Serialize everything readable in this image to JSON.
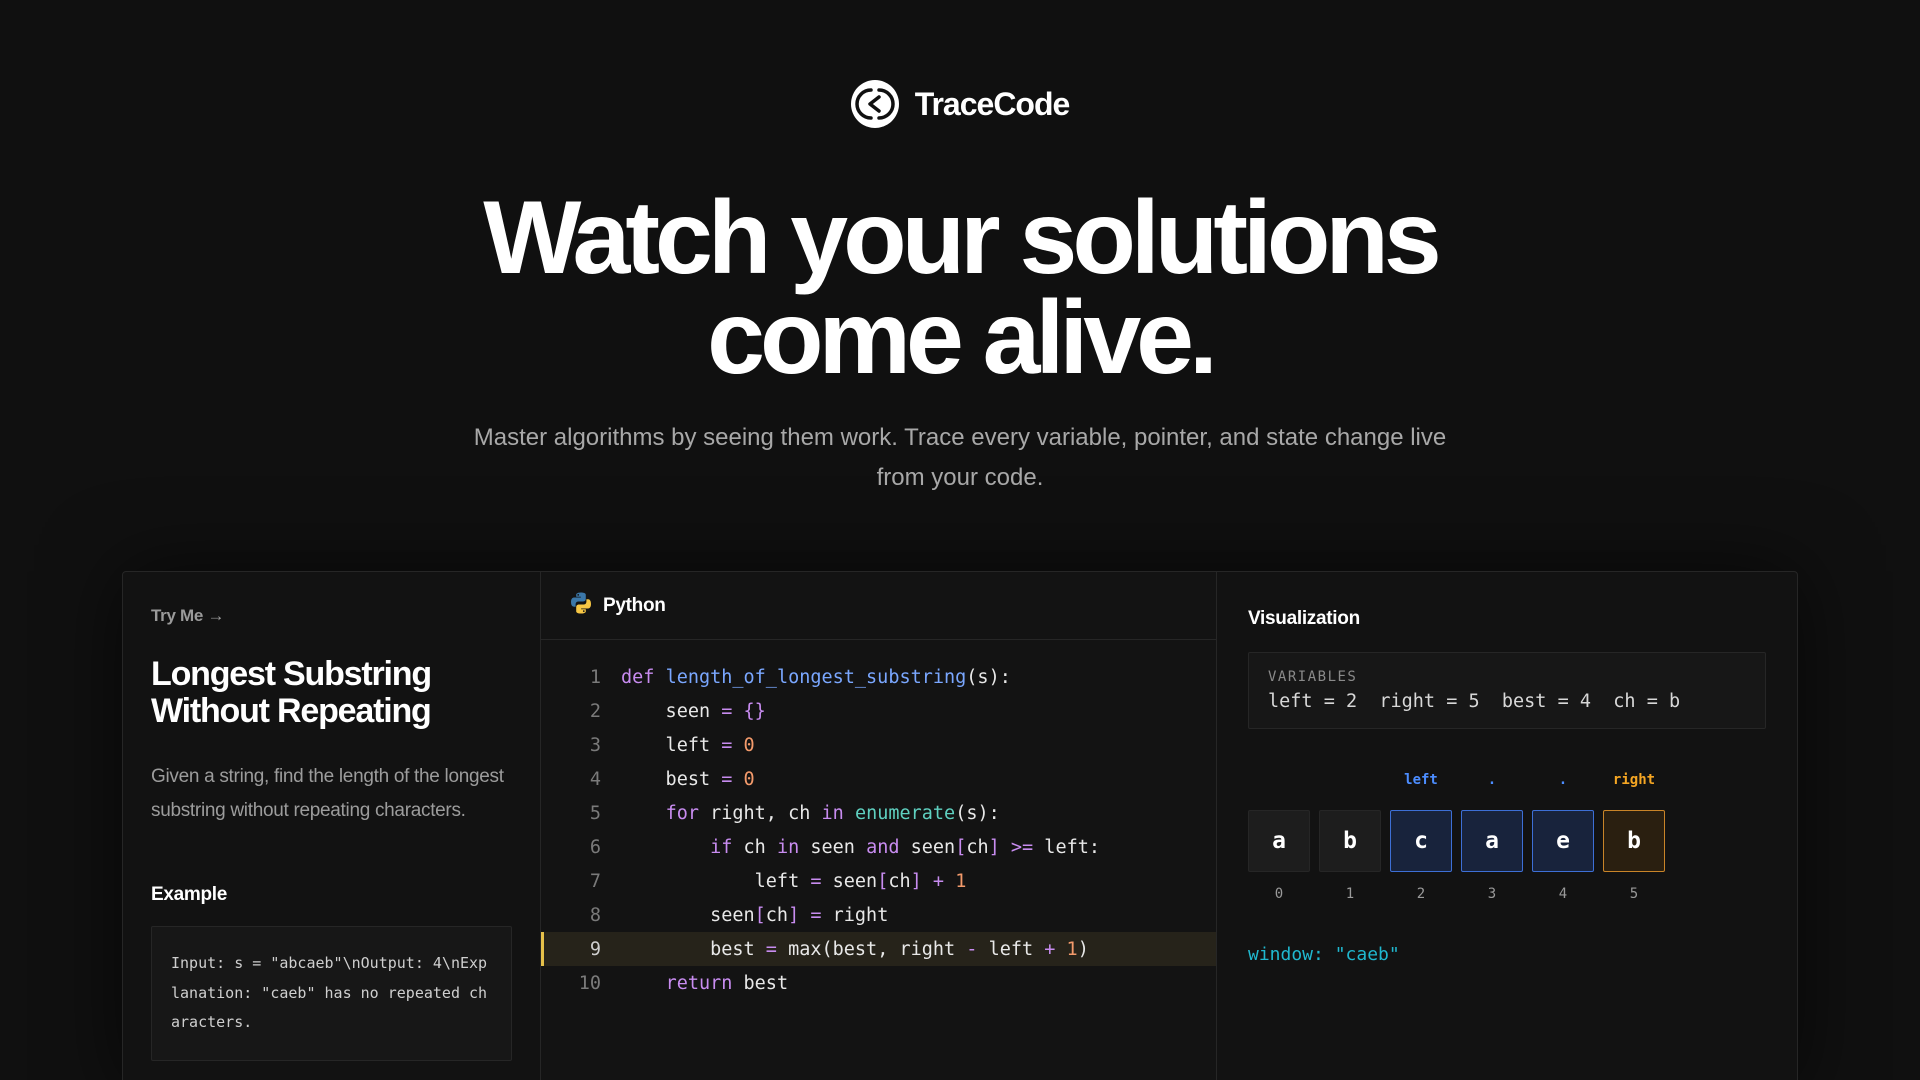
{
  "brand": {
    "name": "TraceCode",
    "logo_icon": "code-bracket-logo-icon"
  },
  "hero": {
    "title_line1": "Watch your solutions",
    "title_line2": "come alive.",
    "subtitle": "Master algorithms by seeing them work. Trace every variable, pointer, and state change live from your code."
  },
  "problem": {
    "try_me": "Try Me →",
    "title": "Longest Substring Without Repeating",
    "description": "Given a string, find the length of the longest substring without repeating characters.",
    "example_heading": "Example",
    "example_text": "Input: s = \"abcaeb\"\\nOutput: 4\\nExplanation: \"caeb\" has no repeated characters."
  },
  "code": {
    "language": "Python",
    "language_icon": "python-icon",
    "active_line": 9,
    "line_numbers": [
      "1",
      "2",
      "3",
      "4",
      "5",
      "6",
      "7",
      "8",
      "9",
      "10"
    ]
  },
  "visualization": {
    "heading": "Visualization",
    "variables_label": "VARIABLES",
    "variables_text": "left = 2  right = 5  best = 4  ch = b",
    "array": [
      {
        "char": "a",
        "index": "0",
        "pointer": "",
        "state": "normal"
      },
      {
        "char": "b",
        "index": "1",
        "pointer": "",
        "state": "normal"
      },
      {
        "char": "c",
        "index": "2",
        "pointer": "left",
        "state": "window"
      },
      {
        "char": "a",
        "index": "3",
        "pointer": ".",
        "state": "window"
      },
      {
        "char": "e",
        "index": "4",
        "pointer": ".",
        "state": "window"
      },
      {
        "char": "b",
        "index": "5",
        "pointer": "right",
        "state": "right"
      }
    ],
    "window_text": "window: \"caeb\""
  },
  "colors": {
    "background": "#101010",
    "keyword": "#c88cf0",
    "function": "#7aa7ff",
    "number": "#f39a6b",
    "builtin": "#5fd0c0",
    "active_line_marker": "#e5c04a",
    "left_pointer": "#4c8dff",
    "right_pointer": "#f5a623",
    "window_text": "#20b8cf"
  }
}
